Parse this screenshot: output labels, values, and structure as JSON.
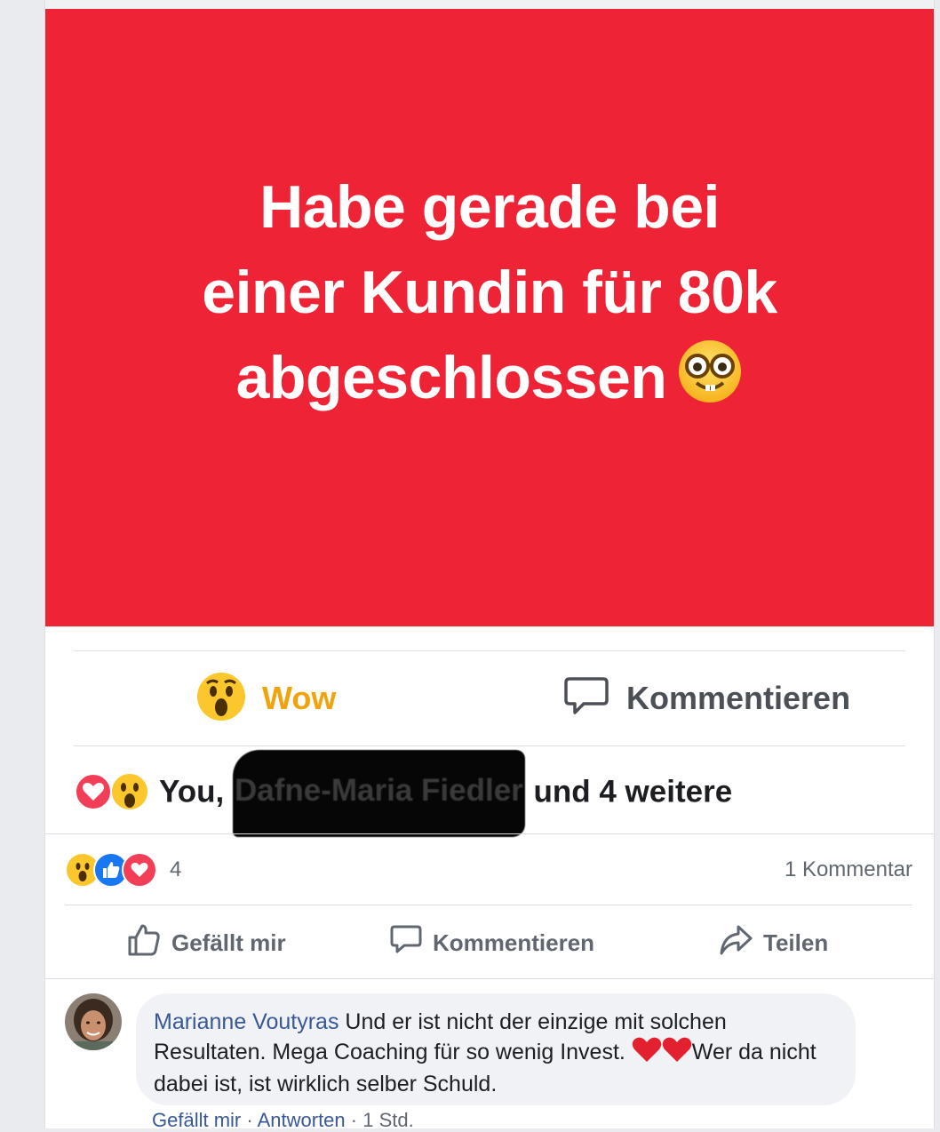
{
  "story": {
    "lines": [
      "Habe gerade bei",
      "einer Kundin für 80k",
      "abgeschlossen"
    ],
    "background_color": "#ee2436",
    "emoji": "nerd-face-emoji"
  },
  "story_actions": {
    "wow_label": "Wow",
    "comment_label": "Kommentieren"
  },
  "story_reactors": {
    "prefix": "You, ",
    "redacted_name": "Dafne-Maria Fiedler",
    "suffix": " und 4 weitere"
  },
  "post_summary": {
    "reaction_count": "4",
    "comment_count_label": "1 Kommentar",
    "reaction_icons": [
      "wow-icon",
      "like-icon",
      "love-icon"
    ]
  },
  "post_actions": {
    "like_label": "Gefällt mir",
    "comment_label": "Kommentieren",
    "share_label": "Teilen"
  },
  "comment": {
    "author": "Marianne Voutyras",
    "text_part1": " Und er ist nicht der einzige mit solchen Resultaten. Mega Coaching für so wenig Invest. ",
    "text_part2": "Wer da nicht dabei ist, ist wirklich selber Schuld.",
    "like_label": "Gefällt mir",
    "reply_label": "Antworten",
    "separator": " · ",
    "time": "1 Std."
  },
  "colors": {
    "accent_link": "#385898",
    "wow_yellow": "#f2a20c",
    "like_blue": "#1877f2",
    "love_red": "#f33e58"
  }
}
